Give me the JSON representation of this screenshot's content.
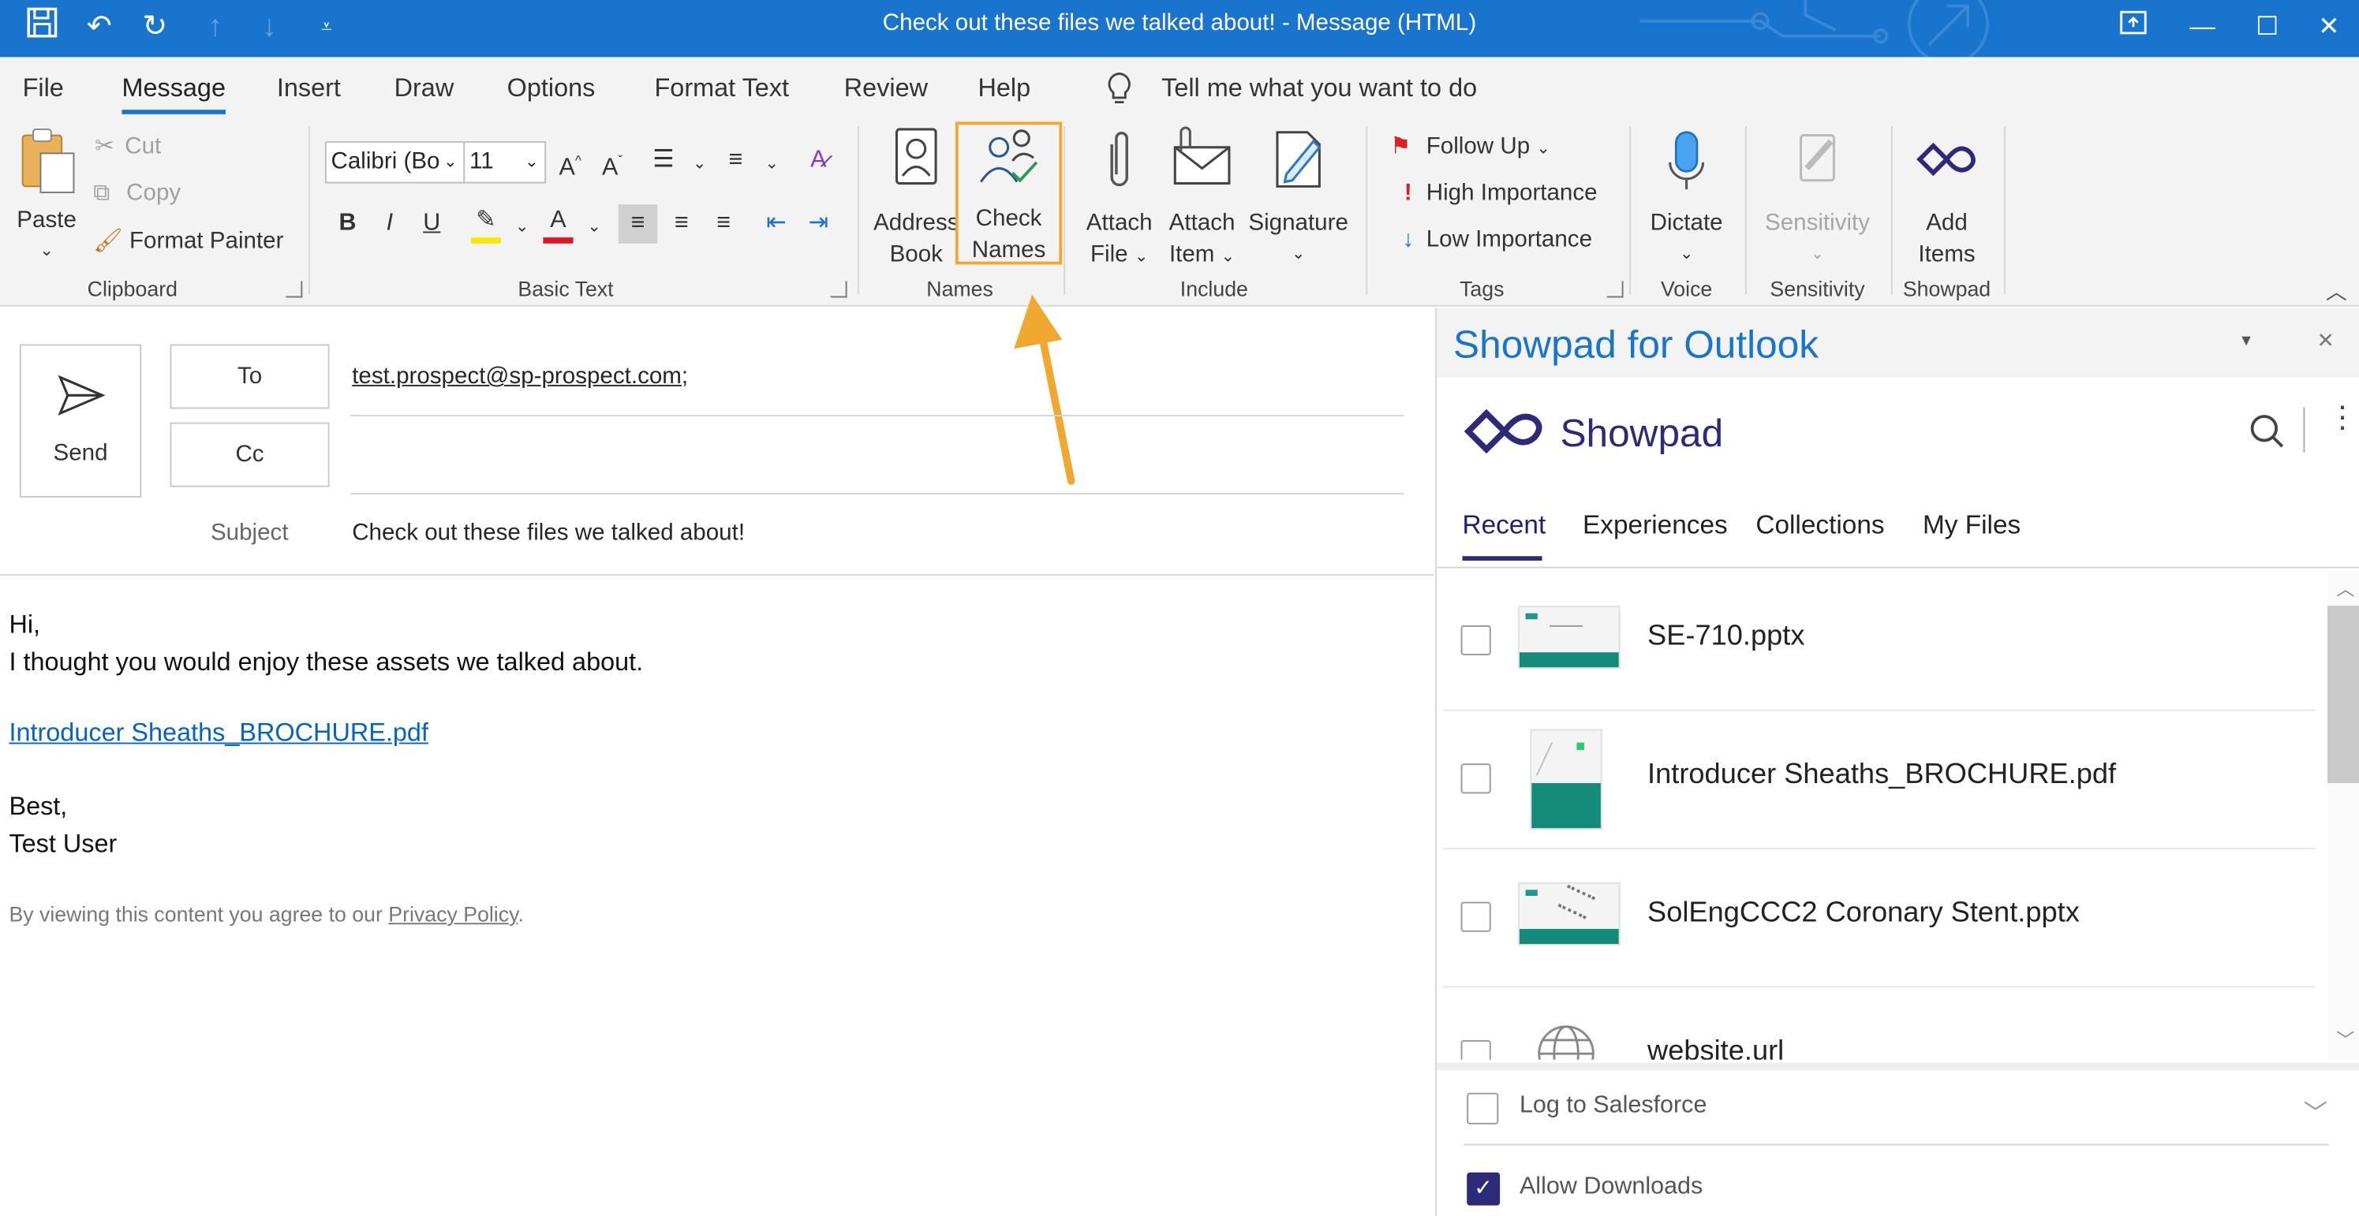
{
  "window": {
    "title": "Check out these files we talked about!  -  Message (HTML)"
  },
  "menu": {
    "tabs": [
      "File",
      "Message",
      "Insert",
      "Draw",
      "Options",
      "Format Text",
      "Review",
      "Help"
    ],
    "active": "Message",
    "tell_me": "Tell me what you want to do"
  },
  "ribbon": {
    "clipboard": {
      "paste": "Paste",
      "cut": "Cut",
      "copy": "Copy",
      "format_painter": "Format Painter",
      "label": "Clipboard"
    },
    "basic_text": {
      "font": "Calibri (Bo",
      "size": "11",
      "label": "Basic Text",
      "highlight_color": "#FFE600",
      "font_color": "#E81123"
    },
    "names": {
      "address_book_1": "Address",
      "address_book_2": "Book",
      "check_names_1": "Check",
      "check_names_2": "Names",
      "label": "Names"
    },
    "include": {
      "attach_file_1": "Attach",
      "attach_file_2": "File",
      "attach_item_1": "Attach",
      "attach_item_2": "Item",
      "signature": "Signature",
      "label": "Include"
    },
    "tags": {
      "follow_up": "Follow Up",
      "high_importance": "High Importance",
      "low_importance": "Low Importance",
      "label": "Tags"
    },
    "voice": {
      "dictate": "Dictate",
      "label": "Voice"
    },
    "sensitivity": {
      "button": "Sensitivity",
      "label": "Sensitivity"
    },
    "showpad": {
      "add_items_1": "Add",
      "add_items_2": "Items",
      "label": "Showpad"
    }
  },
  "compose": {
    "send": "Send",
    "to_button": "To",
    "cc_button": "Cc",
    "to_value": "test.prospect@sp-prospect.com",
    "to_sep": ";",
    "subject_label": "Subject",
    "subject_value": "Check out these files we talked about!",
    "body": {
      "greeting": "Hi,",
      "line1": "I thought you would enjoy these assets we talked about.",
      "link": "Introducer Sheaths_BROCHURE.pdf",
      "closing": "Best,",
      "signature": "Test User",
      "disclaimer_prefix": "By viewing this content you agree to our ",
      "disclaimer_link": "Privacy Policy",
      "disclaimer_suffix": "."
    }
  },
  "pane": {
    "title": "Showpad for Outlook",
    "brand": "Showpad",
    "tabs": [
      "Recent",
      "Experiences",
      "Collections",
      "My Files"
    ],
    "active_tab": "Recent",
    "files": [
      {
        "name": "SE-710.pptx",
        "icon": "pptx-thumbnail"
      },
      {
        "name": "Introducer Sheaths_BROCHURE.pdf",
        "icon": "pdf-thumbnail"
      },
      {
        "name": "SolEngCCC2 Coronary Stent.pptx",
        "icon": "pptx-thumbnail"
      },
      {
        "name": "website.url",
        "icon": "globe-icon"
      }
    ],
    "log_to_salesforce": "Log to Salesforce",
    "allow_downloads": "Allow Downloads",
    "allow_downloads_checked": true
  },
  "colors": {
    "titlebar": "#1874CC",
    "highlight_box": "#F0A830",
    "showpad_brand": "#2E2A7A",
    "link": "#0563C1"
  }
}
